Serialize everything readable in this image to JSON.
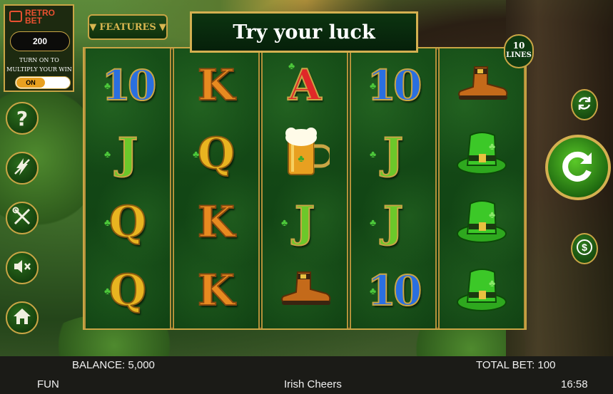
{
  "game": {
    "title_banner": "Try your luck",
    "name": "Irish Cheers",
    "features_label": "FEATURES",
    "lines_count": "10",
    "lines_label": "LINES"
  },
  "retro_bet": {
    "logo_line1": "RETRO",
    "logo_line2": "BET",
    "amount": "200",
    "message": "TURN ON TO MULTIPLY YOUR WIN",
    "toggle_label": "ON"
  },
  "left_buttons": [
    {
      "name": "help-button",
      "icon": "question-icon",
      "glyph": "?"
    },
    {
      "name": "turbo-button",
      "icon": "lightning-off-icon",
      "glyph": "⚡"
    },
    {
      "name": "settings-button",
      "icon": "tools-icon",
      "glyph": "✕"
    },
    {
      "name": "sound-button",
      "icon": "speaker-muted-icon",
      "glyph": "◀x"
    },
    {
      "name": "home-button",
      "icon": "home-icon",
      "glyph": "⌂"
    }
  ],
  "reels": [
    [
      "10",
      "J",
      "Q",
      "Q"
    ],
    [
      "K",
      "Q",
      "K",
      "K"
    ],
    [
      "A",
      "BEER",
      "J",
      "BOOT"
    ],
    [
      "10",
      "J",
      "J",
      "10"
    ],
    [
      "BOOT",
      "HAT",
      "HAT",
      "HAT"
    ]
  ],
  "symbol_icons": {
    "BEER": "beer-mug-icon",
    "BOOT": "leprechaun-boot-icon",
    "HAT": "leprechaun-hat-icon"
  },
  "status": {
    "balance_label": "BALANCE: 5,000",
    "total_bet_label": "TOTAL BET: 100",
    "mode": "FUN",
    "time": "16:58"
  },
  "colors": {
    "gold": "#c9a545",
    "felt": "#0f3a12"
  }
}
